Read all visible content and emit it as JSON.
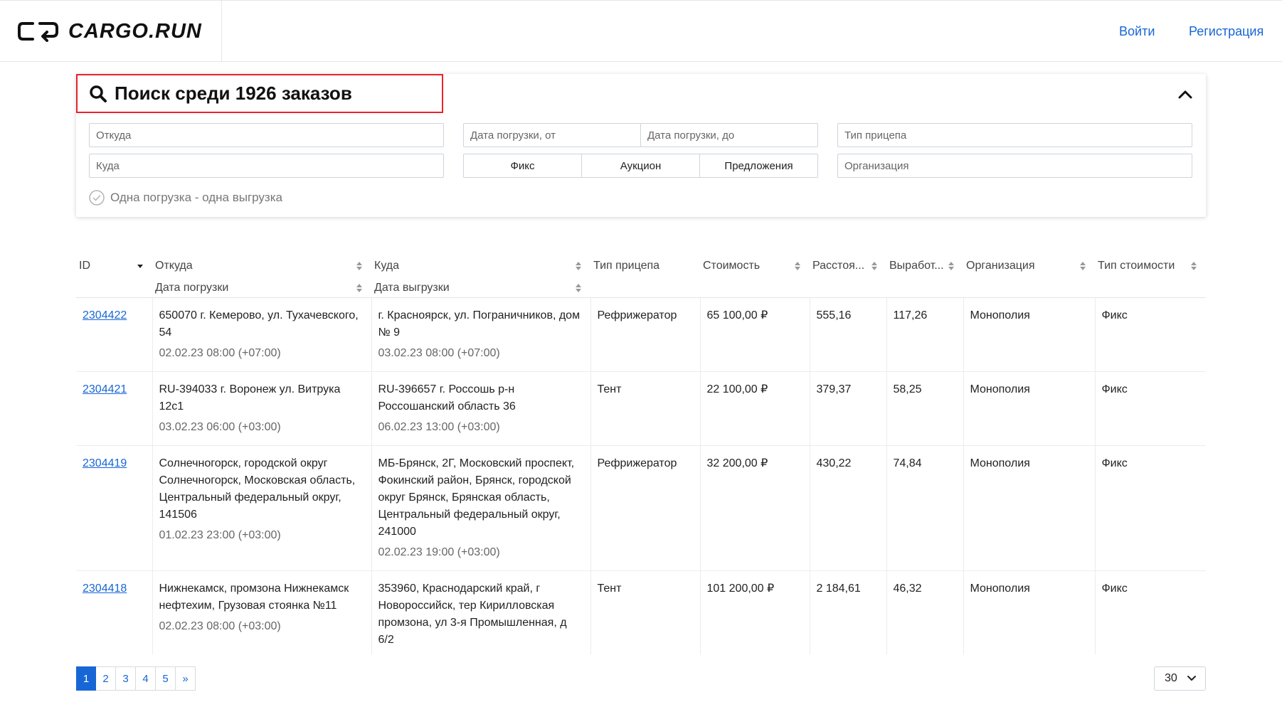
{
  "header": {
    "logo_text": "CARGO.RUN",
    "login_label": "Войти",
    "register_label": "Регистрация"
  },
  "search": {
    "title": "Поиск среди 1926 заказов",
    "from_placeholder": "Откуда",
    "to_placeholder": "Куда",
    "date_from_placeholder": "Дата погрузки, от",
    "date_to_placeholder": "Дата погрузки, до",
    "trailer_placeholder": "Тип прицепа",
    "org_placeholder": "Организация",
    "segments": [
      "Фикс",
      "Аукцион",
      "Предложения"
    ],
    "single_load_label": "Одна погрузка - одна выгрузка"
  },
  "table": {
    "headers": {
      "id": "ID",
      "from": "Откуда",
      "load_date": "Дата погрузки",
      "to": "Куда",
      "unload_date": "Дата выгрузки",
      "trailer": "Тип прицепа",
      "cost": "Стоимость",
      "distance": "Расстоя...",
      "rate": "Выработ...",
      "org": "Организация",
      "cost_type": "Тип стоимости"
    },
    "rows": [
      {
        "id": "2304422",
        "from": "650070 г. Кемерово, ул. Тухачевского, 54",
        "load_date": "02.02.23 08:00 (+07:00)",
        "to": "г. Красноярск, ул. Пограничников, дом № 9",
        "unload_date": "03.02.23 08:00 (+07:00)",
        "trailer": "Рефрижератор",
        "cost": "65 100,00 ₽",
        "distance": "555,16",
        "rate": "117,26",
        "org": "Монополия",
        "cost_type": "Фикс"
      },
      {
        "id": "2304421",
        "from": "RU-394033 г. Воронеж ул. Витрука 12с1",
        "load_date": "03.02.23 06:00 (+03:00)",
        "to": "RU-396657 г. Россошь р-н Россошанский область 36",
        "unload_date": "06.02.23 13:00 (+03:00)",
        "trailer": "Тент",
        "cost": "22 100,00 ₽",
        "distance": "379,37",
        "rate": "58,25",
        "org": "Монополия",
        "cost_type": "Фикс"
      },
      {
        "id": "2304419",
        "from": "Солнечногорск, городской округ Солнечногорск, Московская область, Центральный федеральный округ, 141506",
        "load_date": "01.02.23 23:00 (+03:00)",
        "to": "МБ-Брянск, 2Г, Московский проспект, Фокинский район, Брянск, городской округ Брянск, Брянская область, Центральный федеральный округ, 241000",
        "unload_date": "02.02.23 19:00 (+03:00)",
        "trailer": "Рефрижератор",
        "cost": "32 200,00 ₽",
        "distance": "430,22",
        "rate": "74,84",
        "org": "Монополия",
        "cost_type": "Фикс"
      },
      {
        "id": "2304418",
        "from": "Нижнекамск, промзона Нижнекамск нефтехим, Грузовая стоянка №11",
        "load_date": "02.02.23 08:00 (+03:00)",
        "to": "353960, Краснодарский край, г Новороссийск, тер Кирилловская промзона, ул 3-я Промышленная, д 6/2",
        "unload_date": "",
        "trailer": "Тент",
        "cost": "101 200,00 ₽",
        "distance": "2 184,61",
        "rate": "46,32",
        "org": "Монополия",
        "cost_type": "Фикс"
      }
    ]
  },
  "pagination": {
    "pages": [
      "1",
      "2",
      "3",
      "4",
      "5"
    ],
    "next_label": "»",
    "active_page": "1",
    "per_page": "30"
  },
  "colors": {
    "accent": "#1766d6",
    "highlight_border": "#e8232a"
  }
}
